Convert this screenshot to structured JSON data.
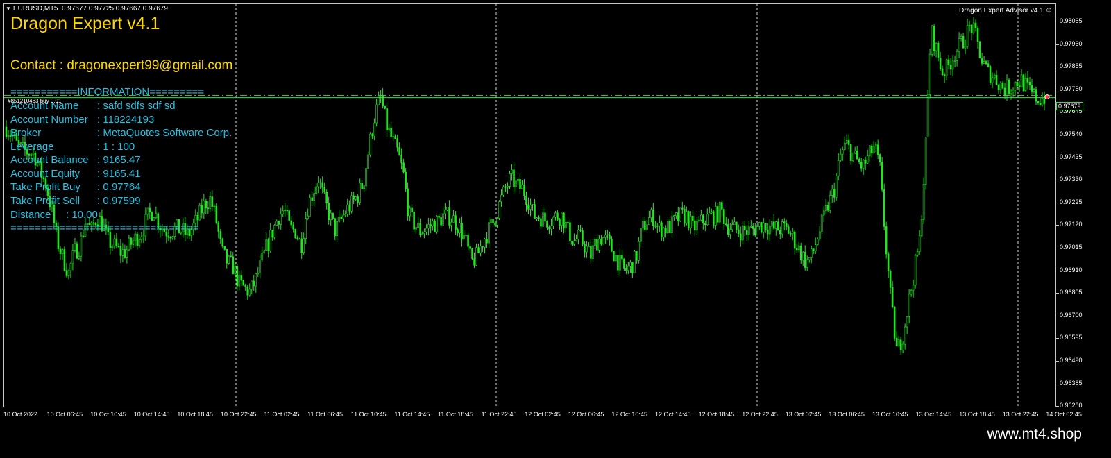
{
  "header": {
    "symbol": "EURUSD,M15",
    "ohlc": "0.97677 0.97725 0.97667 0.97679",
    "ea_name": "Dragon Expert Advisor v4.1"
  },
  "overlay": {
    "title": "Dragon Expert v4.1",
    "contact": "Contact : dragonexpert99@gmail.com",
    "info_header": "===========INFORMATION=========",
    "info_rows": [
      {
        "label": "Account Name",
        "value": ":  safd   sdfs sdf  sd"
      },
      {
        "label": "Account Number",
        "value": ":  118224193"
      },
      {
        "label": "Broker",
        "value": ":  MetaQuotes Software Corp."
      },
      {
        "label": "Leverage",
        "value": ":   1 : 100"
      },
      {
        "label": "Account Balance",
        "value": ":  9165.47"
      },
      {
        "label": "Account Equity",
        "value": ":  9165.41"
      },
      {
        "label": "Take Profit Buy",
        "value": ":  0.97764"
      },
      {
        "label": "Take Profit Sell",
        "value": ":  0.97599"
      },
      {
        "label": "Distance",
        "value": ":   10.00"
      }
    ],
    "info_footer": "===============================",
    "order_tag": "#851210463 buy 0.01"
  },
  "price_axis": {
    "ticks": [
      "0.98065",
      "0.97960",
      "0.97855",
      "0.97750",
      "0.97645",
      "0.97540",
      "0.97435",
      "0.97330",
      "0.97225",
      "0.97120",
      "0.97015",
      "0.96910",
      "0.96805",
      "0.96700",
      "0.96595",
      "0.96490",
      "0.96385",
      "0.96280"
    ],
    "current_price": "0.97679"
  },
  "time_axis": {
    "ticks": [
      "10 Oct 2022",
      "10 Oct 06:45",
      "10 Oct 10:45",
      "10 Oct 14:45",
      "10 Oct 18:45",
      "10 Oct 22:45",
      "11 Oct 02:45",
      "11 Oct 06:45",
      "11 Oct 10:45",
      "11 Oct 14:45",
      "11 Oct 18:45",
      "11 Oct 22:45",
      "12 Oct 02:45",
      "12 Oct 06:45",
      "12 Oct 10:45",
      "12 Oct 14:45",
      "12 Oct 18:45",
      "12 Oct 22:45",
      "13 Oct 02:45",
      "13 Oct 06:45",
      "13 Oct 10:45",
      "13 Oct 14:45",
      "13 Oct 18:45",
      "13 Oct 22:45",
      "14 Oct 02:45"
    ]
  },
  "chart_data": {
    "type": "candlestick",
    "symbol": "EURUSD",
    "timeframe": "M15",
    "ylim": [
      0.9622,
      0.9812
    ],
    "current_price": 0.97679,
    "price_path": [
      0.9754,
      0.975,
      0.9745,
      0.9743,
      0.9742,
      0.9741,
      0.9733,
      0.9727,
      0.9715,
      0.97,
      0.9692,
      0.9685,
      0.9695,
      0.9698,
      0.971,
      0.9705,
      0.9712,
      0.9708,
      0.97,
      0.9698,
      0.9695,
      0.9695,
      0.9699,
      0.9702,
      0.9705,
      0.9712,
      0.9715,
      0.9708,
      0.9705,
      0.9705,
      0.9706,
      0.9705,
      0.9703,
      0.9707,
      0.9712,
      0.9718,
      0.972,
      0.971,
      0.9695,
      0.969,
      0.9688,
      0.968,
      0.9678,
      0.9676,
      0.9682,
      0.969,
      0.9698,
      0.9705,
      0.9712,
      0.9715,
      0.9706,
      0.9705,
      0.9698,
      0.9715,
      0.9723,
      0.973,
      0.972,
      0.9712,
      0.9705,
      0.971,
      0.9715,
      0.9718,
      0.9722,
      0.9728,
      0.9745,
      0.976,
      0.9768,
      0.9755,
      0.9748,
      0.9742,
      0.9732,
      0.9712,
      0.9708,
      0.9705,
      0.9706,
      0.9708,
      0.9709,
      0.9712,
      0.9712,
      0.971,
      0.9706,
      0.97,
      0.969,
      0.9693,
      0.97,
      0.9705,
      0.971,
      0.9718,
      0.9725,
      0.973,
      0.9726,
      0.9725,
      0.972,
      0.9712,
      0.9712,
      0.971,
      0.971,
      0.9712,
      0.9712,
      0.9705,
      0.97,
      0.9702,
      0.9698,
      0.9693,
      0.97,
      0.9702,
      0.97,
      0.9695,
      0.969,
      0.9686,
      0.9688,
      0.9692,
      0.9705,
      0.971,
      0.9712,
      0.9706,
      0.9706,
      0.9707,
      0.971,
      0.9712,
      0.9712,
      0.9706,
      0.9708,
      0.971,
      0.9712,
      0.9712,
      0.9715,
      0.9708,
      0.9706,
      0.9705,
      0.9705,
      0.9705,
      0.9706,
      0.9708,
      0.9708,
      0.9706,
      0.9706,
      0.9706,
      0.9705,
      0.97,
      0.9695,
      0.969,
      0.9693,
      0.9702,
      0.971,
      0.9718,
      0.9725,
      0.974,
      0.9746,
      0.9742,
      0.9738,
      0.9735,
      0.974,
      0.9745,
      0.9735,
      0.97,
      0.967,
      0.9648,
      0.9655,
      0.967,
      0.9685,
      0.97,
      0.974,
      0.98,
      0.979,
      0.978,
      0.9782,
      0.9788,
      0.9792,
      0.9796,
      0.9802,
      0.9796,
      0.9785,
      0.978,
      0.9778,
      0.9775,
      0.9772,
      0.9773,
      0.9775,
      0.9776,
      0.9772,
      0.9769,
      0.9767,
      0.9768
    ]
  }
}
